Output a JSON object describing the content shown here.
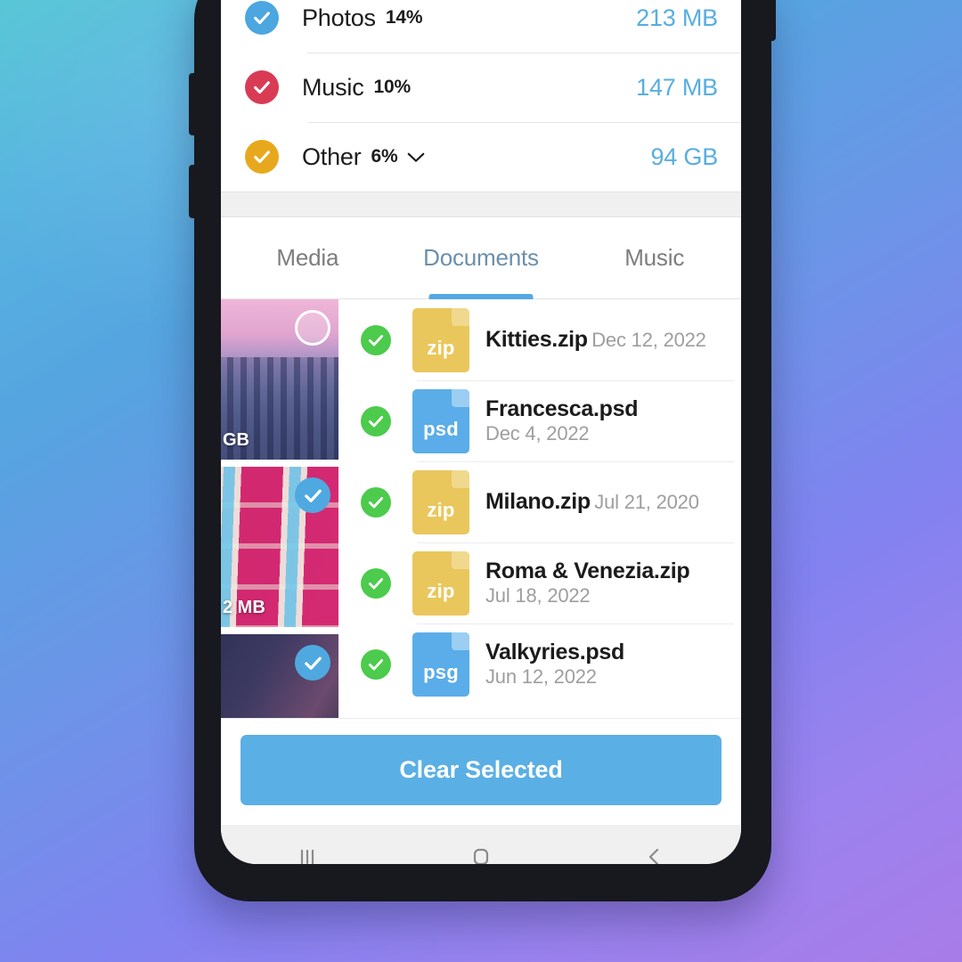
{
  "colors": {
    "accent_blue": "#57aee0",
    "photos_blue": "#4ca6e0",
    "music_red": "#d93b55",
    "other_amber": "#e8a81e",
    "doc_check_green": "#4ccb4c",
    "zip_yellow": "#e9c75c",
    "psd_blue": "#5aade8",
    "cta_blue": "#5aafe4",
    "tab_active": "#6a8fad",
    "bg_gradient_from": "#57c6d6",
    "bg_gradient_to": "#a87ce8"
  },
  "storage": {
    "categories": [
      {
        "label": "Photos",
        "percent": "14%",
        "size": "213 MB",
        "check_color": "#4ca6e0",
        "checked": true,
        "expandable": false
      },
      {
        "label": "Music",
        "percent": "10%",
        "size": "147 MB",
        "check_color": "#d93b55",
        "checked": true,
        "expandable": false
      },
      {
        "label": "Other",
        "percent": "6%",
        "size": "94 GB",
        "check_color": "#e8a81e",
        "checked": true,
        "expandable": true
      }
    ]
  },
  "tabs": {
    "items": [
      {
        "label": "Media",
        "active": false
      },
      {
        "label": "Documents",
        "active": true
      },
      {
        "label": "Music",
        "active": false
      }
    ]
  },
  "media_strip": {
    "cards": [
      {
        "size_label": "GB",
        "selected": false
      },
      {
        "size_label": "2 MB",
        "selected": true
      },
      {
        "size_label": "",
        "selected": true
      }
    ]
  },
  "documents": {
    "rows": [
      {
        "name": "Kitties.zip",
        "date": "Dec 12, 2022",
        "ext": "zip",
        "icon_kind": "zip",
        "checked": true
      },
      {
        "name": "Francesca.psd",
        "date": "Dec 4, 2022",
        "ext": "psd",
        "icon_kind": "psd",
        "checked": true
      },
      {
        "name": "Milano.zip",
        "date": "Jul 21, 2020",
        "ext": "zip",
        "icon_kind": "zip",
        "checked": true
      },
      {
        "name": "Roma & Venezia.zip",
        "date": "Jul 18, 2022",
        "ext": "zip",
        "icon_kind": "zip",
        "checked": true
      },
      {
        "name": "Valkyries.psd",
        "date": "Jun 12, 2022",
        "ext": "psg",
        "icon_kind": "psd",
        "checked": true
      }
    ]
  },
  "cta": {
    "label": "Clear Selected"
  },
  "navbar": {
    "recents_icon": "recents-icon",
    "home_icon": "home-icon",
    "back_icon": "back-icon"
  }
}
